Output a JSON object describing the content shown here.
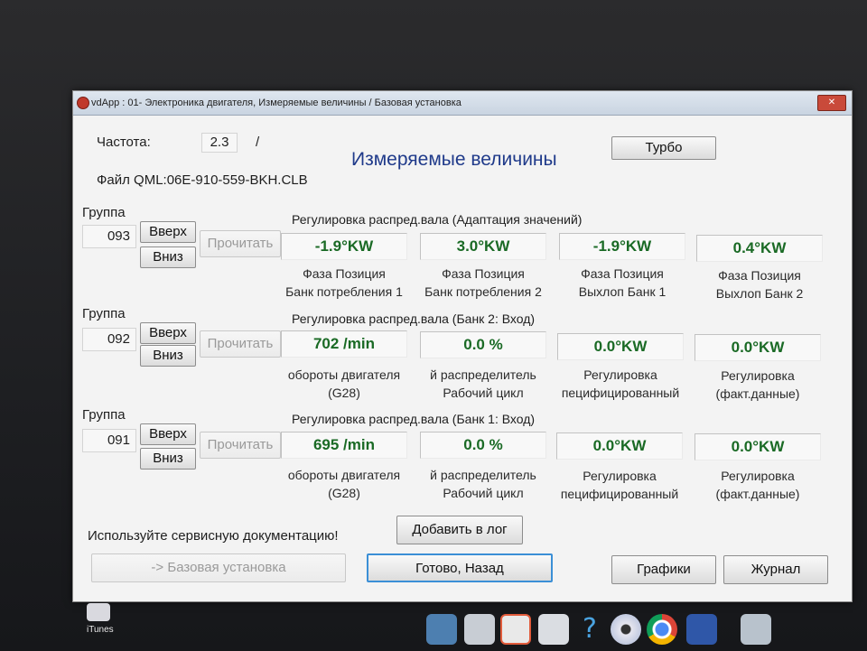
{
  "window": {
    "title": "vdApp : 01- Электроника двигателя,  Измеряемые величины / Базовая установка",
    "close_label": "✕"
  },
  "header": {
    "frequency_label": "Частота:",
    "frequency_value": "2.3",
    "frequency_sep": "/",
    "heading": "Измеряемые величины",
    "turbo_button": "Турбо",
    "file_label": "Файл QML:06E-910-559-BKH.CLB"
  },
  "group_label": "Группа",
  "up_label": "Вверх",
  "down_label": "Вниз",
  "read_label": "Прочитать",
  "groups": [
    {
      "number": "093",
      "caption": "Регулировка распред.вала (Адаптация значений)",
      "cells": [
        {
          "value": "-1.9°KW",
          "line1": "Фаза Позиция",
          "line2": "Банк потребления 1"
        },
        {
          "value": "3.0°KW",
          "line1": "Фаза Позиция",
          "line2": "Банк потребления 2"
        },
        {
          "value": "-1.9°KW",
          "line1": "Фаза Позиция",
          "line2": "Выхлоп Банк 1"
        },
        {
          "value": "0.4°KW",
          "line1": "Фаза Позиция",
          "line2": "Выхлоп Банк 2"
        }
      ]
    },
    {
      "number": "092",
      "caption": "Регулировка распред.вала (Банк 2: Вход)",
      "cells": [
        {
          "value": "702 /min",
          "line1": "обороты двигателя",
          "line2": "(G28)"
        },
        {
          "value": "0.0 %",
          "line1": "й распределитель",
          "line2": "Рабочий цикл"
        },
        {
          "value": "0.0°KW",
          "line1": "Регулировка",
          "line2": "пецифицированный"
        },
        {
          "value": "0.0°KW",
          "line1": "Регулировка",
          "line2": "(факт.данные)"
        }
      ]
    },
    {
      "number": "091",
      "caption": "Регулировка распред.вала (Банк 1: Вход)",
      "cells": [
        {
          "value": "695 /min",
          "line1": "обороты двигателя",
          "line2": "(G28)"
        },
        {
          "value": "0.0 %",
          "line1": "й распределитель",
          "line2": "Рабочий цикл"
        },
        {
          "value": "0.0°KW",
          "line1": "Регулировка",
          "line2": "пецифицированный"
        },
        {
          "value": "0.0°KW",
          "line1": "Регулировка",
          "line2": "(факт.данные)"
        }
      ]
    }
  ],
  "footer": {
    "service_note": "Используйте сервисную документацию!",
    "add_log_button": "Добавить в лог",
    "basic_setting_button": "-> Базовая установка",
    "done_button": "Готово, Назад",
    "graphs_button": "Графики",
    "journal_button": "Журнал"
  },
  "desktop": {
    "itunes_label": "iTunes"
  },
  "colors": {
    "value_green": "#1a6a25",
    "heading_blue": "#1f3a8a",
    "done_border": "#3b8fd6"
  }
}
